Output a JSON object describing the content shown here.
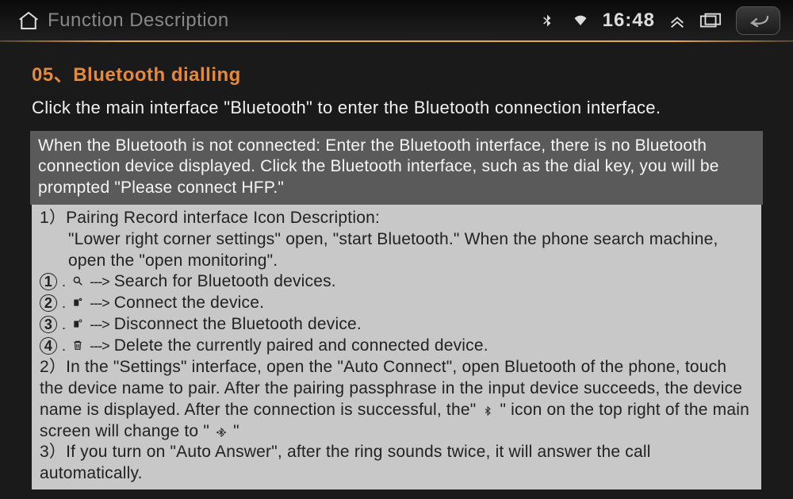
{
  "header": {
    "title": "Function Description",
    "clock": "16:48"
  },
  "section": {
    "title": "05、Bluetooth dialling",
    "intro": "Click the main interface \"Bluetooth\" to enter the Bluetooth connection interface.",
    "note": "When the Bluetooth is not connected: Enter the Bluetooth interface, there is no Bluetooth connection device displayed. Click the Bluetooth interface, such as the dial key, you will be prompted \"Please connect HFP.\""
  },
  "list": {
    "p1_head": "1）Pairing Record interface Icon Description:",
    "p1_body": "\"Lower right corner settings\" open, \"start Bluetooth.\" When the phone search machine, open the \"open monitoring\".",
    "c1": "1",
    "c1_txt": "Search for Bluetooth devices.",
    "c2": "2",
    "c2_txt": "Connect the device.",
    "c3": "3",
    "c3_txt": "Disconnect the Bluetooth device.",
    "c4": "4",
    "c4_txt": "Delete the currently paired and connected device.",
    "p2": "2）In the \"Settings\" interface, open the \"Auto Connect\", open Bluetooth of the phone, touch the device name to pair. After the pairing passphrase in the input device succeeds, the device name is displayed. After the connection is successful, the\"  \" icon on the top right of the main screen will change to \"  \"",
    "p3": "3）If you turn on \"Auto Answer\", after the ring sounds twice, it will answer the call automatically."
  }
}
